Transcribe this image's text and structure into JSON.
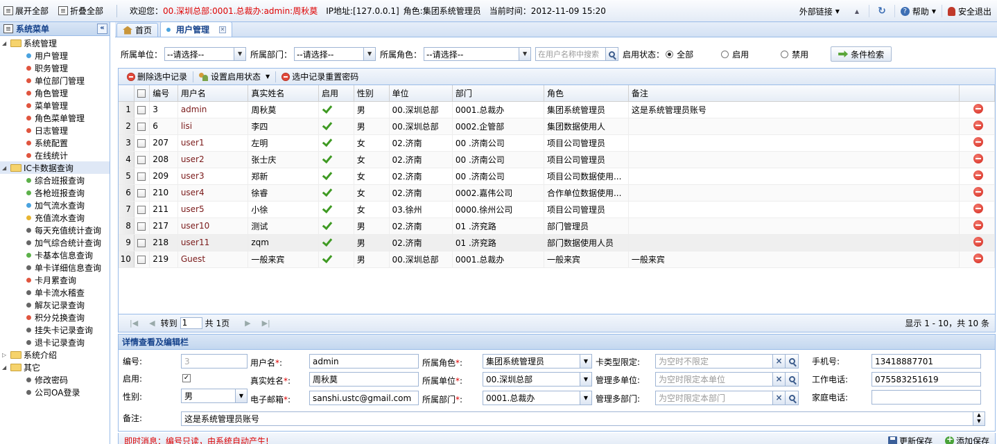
{
  "topbar": {
    "expand_all": "展开全部",
    "collapse_all": "折叠全部",
    "welcome_prefix": "欢迎您：",
    "user_path": "00.深圳总部:0001.总裁办:admin:周秋莫",
    "ip": "IP地址:[127.0.0.1]",
    "role": "角色:集团系统管理员",
    "time": "当前时间：2012-11-09 15:20",
    "external_links": "外部链接",
    "help": "帮助",
    "logout": "安全退出"
  },
  "sidebar": {
    "title": "系统菜单",
    "groups": [
      {
        "label": "系统管理",
        "items": [
          "用户管理",
          "职务管理",
          "单位部门管理",
          "角色管理",
          "菜单管理",
          "角色菜单管理",
          "日志管理",
          "系统配置",
          "在线统计"
        ]
      },
      {
        "label": "IC卡数据查询",
        "items": [
          "综合班报查询",
          "各枪班报查询",
          "加气流水查询",
          "充值流水查询",
          "每天充值统计查询",
          "加气综合统计查询",
          "卡基本信息查询",
          "单卡详细信息查询",
          "卡月累查询",
          "单卡流水稽查",
          "解灰记录查询",
          "积分兑换查询",
          "挂失卡记录查询",
          "退卡记录查询"
        ]
      },
      {
        "label": "系统介绍",
        "items": []
      },
      {
        "label": "其它",
        "items": [
          "修改密码",
          "公司OA登录"
        ]
      }
    ],
    "dot_colors": [
      "#4aa3df",
      "#e0553f",
      "#e0553f",
      "#e0553f",
      "#e0553f",
      "#e0553f",
      "#e0553f",
      "#e0553f",
      "#e0553f"
    ],
    "ic_dot_colors": [
      "#5db14a",
      "#5db14a",
      "#4aa3df",
      "#e8b531",
      "#666",
      "#666",
      "#5db14a",
      "#666",
      "#e0553f",
      "#666",
      "#666",
      "#e0553f",
      "#666",
      "#666"
    ]
  },
  "tabs": {
    "home": "首页",
    "user_mgmt": "用户管理"
  },
  "search": {
    "unit_label": "所属单位：",
    "unit_value": "--请选择--",
    "dept_label": "所属部门：",
    "dept_value": "--请选择--",
    "role_label": "所属角色：",
    "role_value": "--请选择--",
    "name_placeholder": "在用户名称中搜索",
    "status_label": "启用状态：",
    "status_all": "全部",
    "status_on": "启用",
    "status_off": "禁用",
    "search_button": "条件检索"
  },
  "grid_toolbar": {
    "delete_selected": "删除选中记录",
    "set_enabled": "设置启用状态",
    "reset_password": "选中记录重置密码"
  },
  "grid": {
    "headers": [
      "编号",
      "用户名",
      "真实姓名",
      "启用",
      "性别",
      "单位",
      "部门",
      "角色",
      "备注"
    ],
    "rows": [
      {
        "n": "1",
        "id": "3",
        "user": "admin",
        "name": "周秋莫",
        "sex": "男",
        "unit": "00.深圳总部",
        "dept": "0001.总裁办",
        "role": "集团系统管理员",
        "note": "这是系统管理员账号"
      },
      {
        "n": "2",
        "id": "6",
        "user": "lisi",
        "name": "李四",
        "sex": "男",
        "unit": "00.深圳总部",
        "dept": "0002.企管部",
        "role": "集团数据使用人",
        "note": ""
      },
      {
        "n": "3",
        "id": "207",
        "user": "user1",
        "name": "左明",
        "sex": "女",
        "unit": "02.济南",
        "dept": "00 .济南公司",
        "role": "项目公司管理员",
        "note": ""
      },
      {
        "n": "4",
        "id": "208",
        "user": "user2",
        "name": "张士庆",
        "sex": "女",
        "unit": "02.济南",
        "dept": "00 .济南公司",
        "role": "项目公司管理员",
        "note": ""
      },
      {
        "n": "5",
        "id": "209",
        "user": "user3",
        "name": "郑新",
        "sex": "女",
        "unit": "02.济南",
        "dept": "00 .济南公司",
        "role": "项目公司数据使用...",
        "note": ""
      },
      {
        "n": "6",
        "id": "210",
        "user": "user4",
        "name": "徐睿",
        "sex": "女",
        "unit": "02.济南",
        "dept": "0002.嘉伟公司",
        "role": "合作单位数据使用...",
        "note": ""
      },
      {
        "n": "7",
        "id": "211",
        "user": "user5",
        "name": "小徐",
        "sex": "女",
        "unit": "03.徐州",
        "dept": "0000.徐州公司",
        "role": "项目公司管理员",
        "note": ""
      },
      {
        "n": "8",
        "id": "217",
        "user": "user10",
        "name": "测试",
        "sex": "男",
        "unit": "02.济南",
        "dept": "01 .济兖路",
        "role": "部门管理员",
        "note": ""
      },
      {
        "n": "9",
        "id": "218",
        "user": "user11",
        "name": "zqm",
        "sex": "男",
        "unit": "02.济南",
        "dept": "01 .济兖路",
        "role": "部门数据使用人员",
        "note": ""
      },
      {
        "n": "10",
        "id": "219",
        "user": "Guest",
        "name": "一般来宾",
        "sex": "男",
        "unit": "00.深圳总部",
        "dept": "0001.总裁办",
        "role": "一般来宾",
        "note": "一般来宾"
      }
    ]
  },
  "pager": {
    "goto": "转到",
    "page": "1",
    "total": "共 1页",
    "info": "显示 1 - 10，共 10 条"
  },
  "detail": {
    "title": "详情查看及编辑栏",
    "id_label": "编号:",
    "id_value": "3",
    "enabled_label": "启用:",
    "sex_label": "性别:",
    "sex_value": "男",
    "note_label": "备注:",
    "note_value": "这是系统管理员账号",
    "username_label": "用户名",
    "username_value": "admin",
    "realname_label": "真实姓名",
    "realname_value": "周秋莫",
    "email_label": "电子邮箱",
    "email_value": "sanshi.ustc@gmail.com",
    "role_label": "所属角色",
    "role_value": "集团系统管理员",
    "unit_label": "所属单位",
    "unit_value": "00.深圳总部",
    "dept_label": "所属部门",
    "dept_value": "0001.总裁办",
    "cardtype_label": "卡类型限定:",
    "cardtype_ph": "为空时不限定",
    "multiunit_label": "管理多单位:",
    "multiunit_ph": "为空时限定本单位",
    "multidept_label": "管理多部门:",
    "multidept_ph": "为空时限定本部门",
    "mobile_label": "手机号:",
    "mobile_value": "13418887701",
    "workphone_label": "工作电话:",
    "workphone_value": "075583251619",
    "homephone_label": "家庭电话:",
    "homephone_value": ""
  },
  "status": {
    "message": "即时消息：编号只读，由系统自动产生!",
    "update_save": "更新保存",
    "add_save": "添加保存"
  }
}
